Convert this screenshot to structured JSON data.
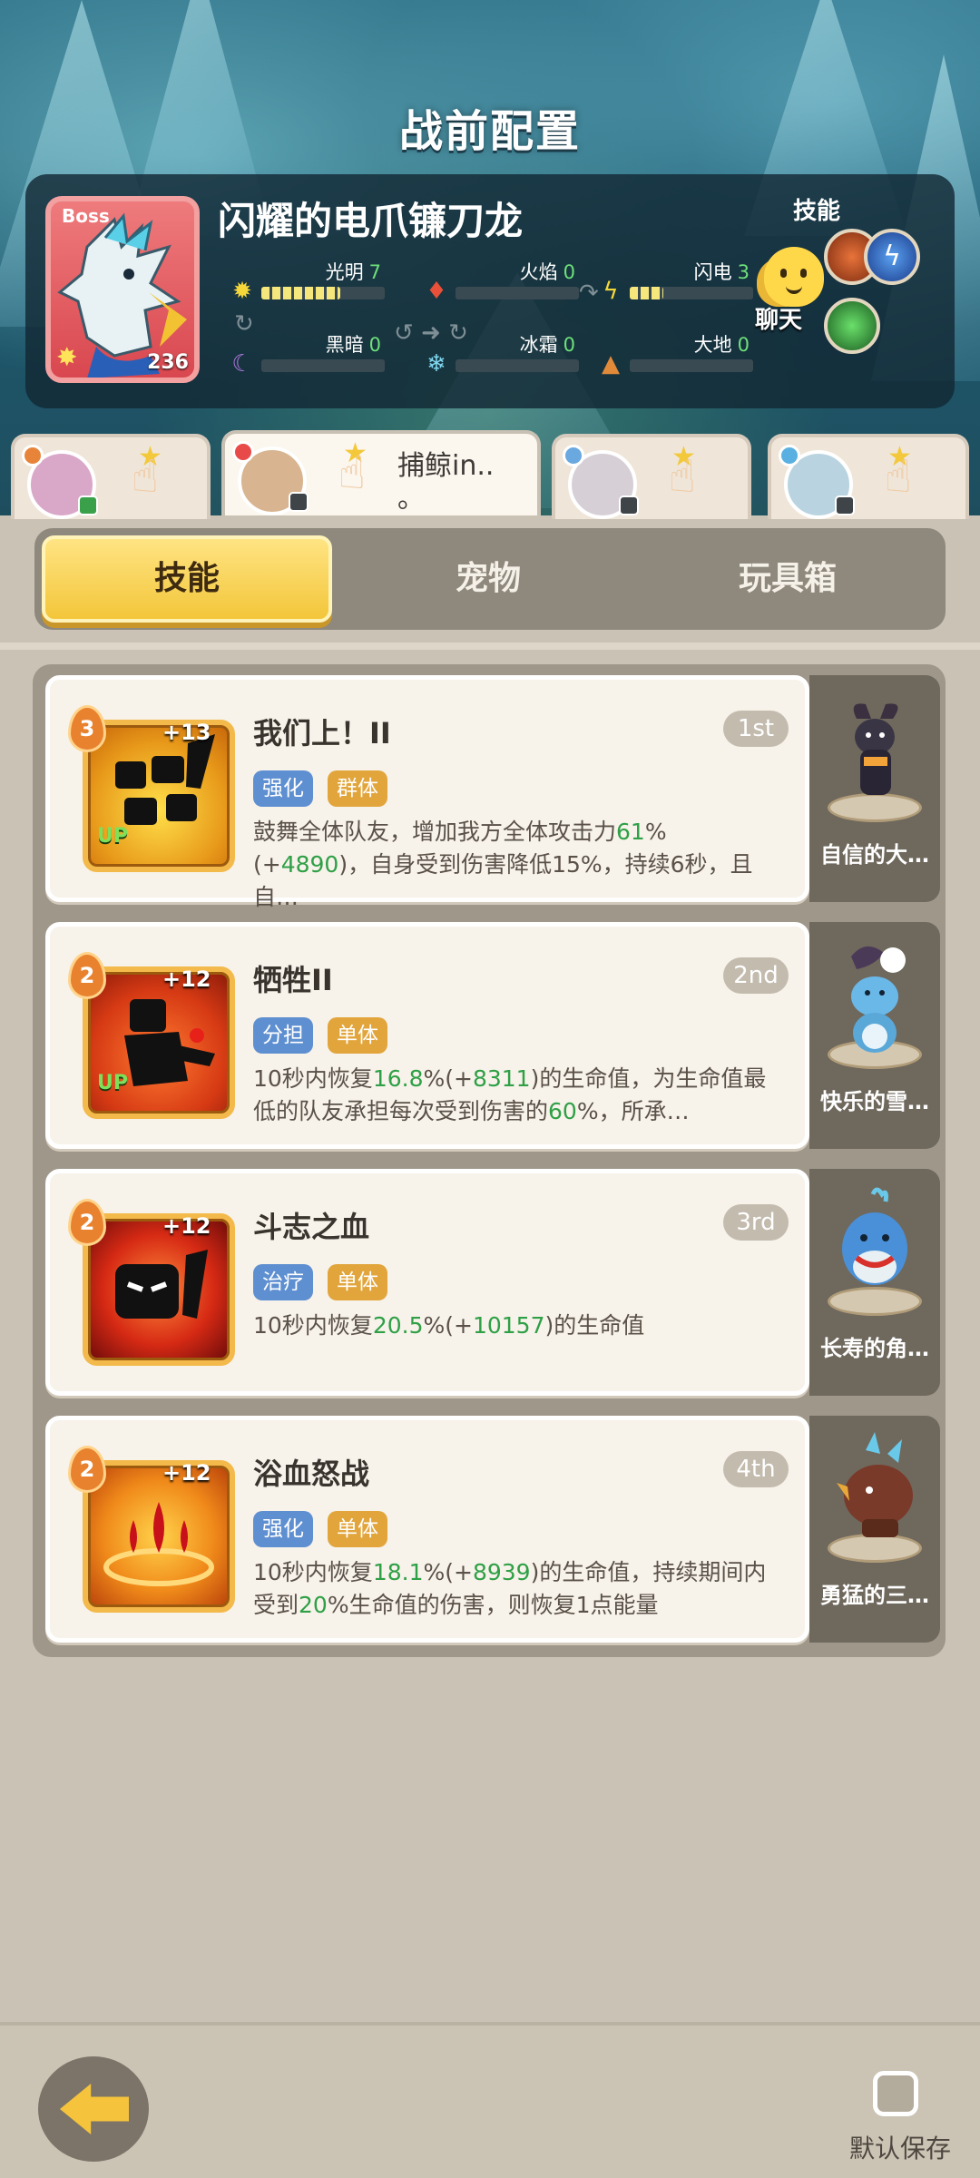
{
  "header": {
    "title": "战前配置"
  },
  "boss": {
    "tag": "Boss",
    "name": "闪耀的电爪镰刀龙",
    "level": "236",
    "elements": [
      {
        "label": "光明",
        "value": "7",
        "icon": "sun-icon",
        "fill": 0.64,
        "color": "#f6e77c"
      },
      {
        "label": "火焰",
        "value": "0",
        "icon": "fire-icon",
        "fill": 0,
        "color": "#e85a3a"
      },
      {
        "label": "闪电",
        "value": "3",
        "icon": "lightning-icon",
        "fill": 0.27,
        "color": "#f6e77c"
      },
      {
        "label": "黑暗",
        "value": "0",
        "icon": "moon-icon",
        "fill": 0,
        "color": "#b07ae0"
      },
      {
        "label": "冰霜",
        "value": "0",
        "icon": "snowflake-icon",
        "fill": 0,
        "color": "#7fd6f0"
      },
      {
        "label": "大地",
        "value": "0",
        "icon": "earth-icon",
        "fill": 0,
        "color": "#e08a3a"
      }
    ],
    "skills_label": "技能",
    "chat_label": "聊天"
  },
  "slots": [
    {
      "active": false,
      "color": "#d9a7c8"
    },
    {
      "active": true,
      "color": "#d8b590",
      "name": "捕鲸in..",
      "name2": "。"
    },
    {
      "active": false,
      "color": "#d6cfd6"
    },
    {
      "active": false,
      "color": "#b9d4e0"
    }
  ],
  "tabs": {
    "skills": "技能",
    "pets": "宠物",
    "toybox": "玩具箱",
    "active": "skills"
  },
  "skills": [
    {
      "name": "我们上！II",
      "rank": "1st",
      "level": "3",
      "plus": "+13",
      "up": "UP",
      "tags": [
        "强化",
        "群体"
      ],
      "desc_parts": [
        {
          "t": "鼓舞全体队友，增加我方全体攻击力",
          "g": false
        },
        {
          "t": "61",
          "g": true
        },
        {
          "t": "%(+",
          "g": false
        },
        {
          "t": "4890",
          "g": true
        },
        {
          "t": ")，自身受到伤害降低15%，持续6秒，且自…",
          "g": false
        }
      ],
      "pet": "自信的大…"
    },
    {
      "name": "牺牲II",
      "rank": "2nd",
      "level": "2",
      "plus": "+12",
      "up": "UP",
      "tags": [
        "分担",
        "单体"
      ],
      "desc_parts": [
        {
          "t": "10秒内恢复",
          "g": false
        },
        {
          "t": "16.8",
          "g": true
        },
        {
          "t": "%(+",
          "g": false
        },
        {
          "t": "8311",
          "g": true
        },
        {
          "t": ")的生命值，为生命值最低的队友承担每次受到伤害的",
          "g": false
        },
        {
          "t": "60",
          "g": true
        },
        {
          "t": "%，所承…",
          "g": false
        }
      ],
      "pet": "快乐的雪…"
    },
    {
      "name": "斗志之血",
      "rank": "3rd",
      "level": "2",
      "plus": "+12",
      "up": "",
      "tags": [
        "治疗",
        "单体"
      ],
      "desc_parts": [
        {
          "t": "10秒内恢复",
          "g": false
        },
        {
          "t": "20.5",
          "g": true
        },
        {
          "t": "%(+",
          "g": false
        },
        {
          "t": "10157",
          "g": true
        },
        {
          "t": ")的生命值",
          "g": false
        }
      ],
      "pet": "长寿的角…"
    },
    {
      "name": "浴血怒战",
      "rank": "4th",
      "level": "2",
      "plus": "+12",
      "up": "",
      "tags": [
        "强化",
        "单体"
      ],
      "desc_parts": [
        {
          "t": "10秒内恢复",
          "g": false
        },
        {
          "t": "18.1",
          "g": true
        },
        {
          "t": "%(+",
          "g": false
        },
        {
          "t": "8939",
          "g": true
        },
        {
          "t": ")的生命值，持续期间内受到",
          "g": false
        },
        {
          "t": "20",
          "g": true
        },
        {
          "t": "%生命值的伤害，则恢复1点能量",
          "g": false
        }
      ],
      "pet": "勇猛的三…"
    }
  ],
  "footer": {
    "save_label": "默认保存"
  }
}
